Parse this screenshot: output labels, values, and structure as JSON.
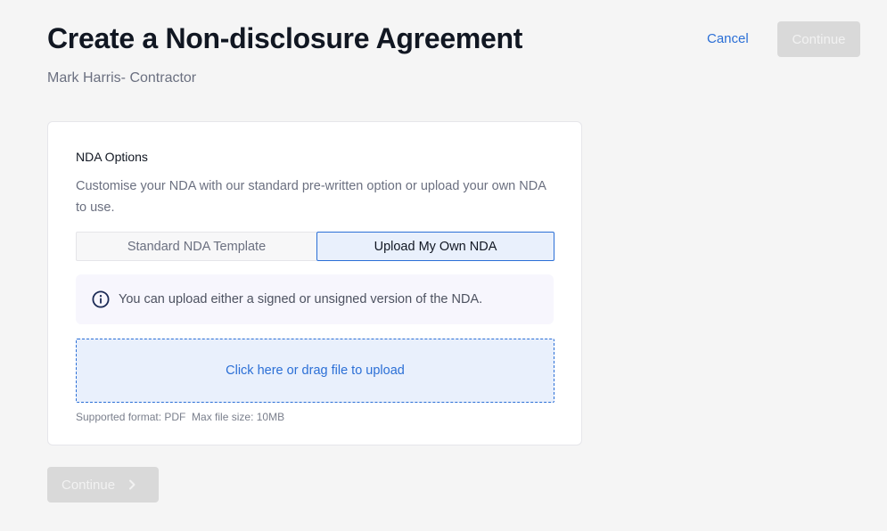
{
  "header": {
    "title": "Create a Non-disclosure Agreement",
    "subtitle": "Mark Harris- Contractor",
    "cancel_label": "Cancel",
    "continue_label": "Continue"
  },
  "card": {
    "heading": "NDA Options",
    "description": "Customise your NDA with our standard pre-written option or upload your own NDA to use.",
    "options": [
      {
        "label": "Standard NDA Template",
        "selected": false
      },
      {
        "label": "Upload My Own NDA",
        "selected": true
      }
    ],
    "info_text": "You can upload either a signed or unsigned version of the NDA.",
    "upload_label": "Click here or drag file to upload",
    "support_note": "Supported format: PDF  Max file size: 10MB"
  },
  "footer": {
    "continue_label": "Continue"
  },
  "colors": {
    "accent": "#2b6fd6",
    "disabled_button": "#d9d9d9",
    "info_bg": "#f7f6fd",
    "dropzone_bg": "#e9f0fc"
  },
  "icons": {
    "info": "info-circle-icon",
    "continue_chevron": "chevron-right-icon"
  }
}
